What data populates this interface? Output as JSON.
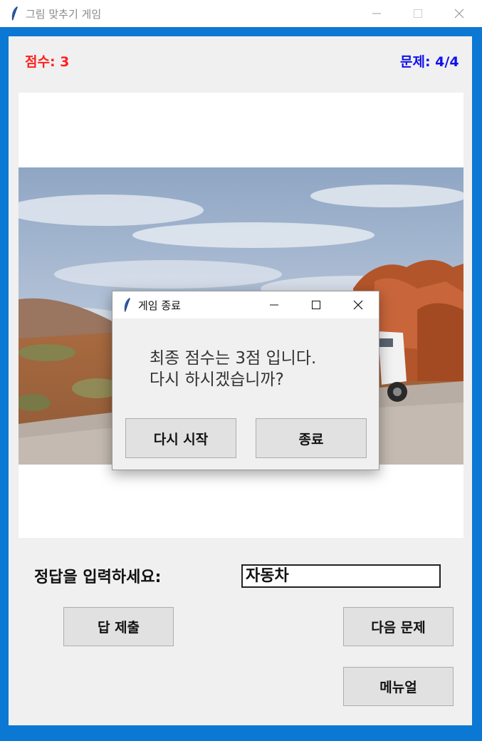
{
  "window": {
    "title": "그림 맞추기 게임",
    "icon": "feather-icon"
  },
  "status": {
    "score": "점수: 3",
    "question": "문제: 4/4",
    "score_color": "#ff2020",
    "question_color": "#1010ee"
  },
  "quiz": {
    "image": "desert road with white SUV and red rocks",
    "prompt": "정답을 입력하세요:",
    "answer_value": "자동차"
  },
  "buttons": {
    "submit": "답 제출",
    "next": "다음 문제",
    "manual": "메뉴얼"
  },
  "dialog": {
    "title": "게임 종료",
    "message_line1": "최종 점수는 3점 입니다.",
    "message_line2": "다시 하시겠습니까?",
    "restart": "다시 시작",
    "quit": "종료"
  },
  "colors": {
    "frame_accent": "#0b78d4"
  }
}
